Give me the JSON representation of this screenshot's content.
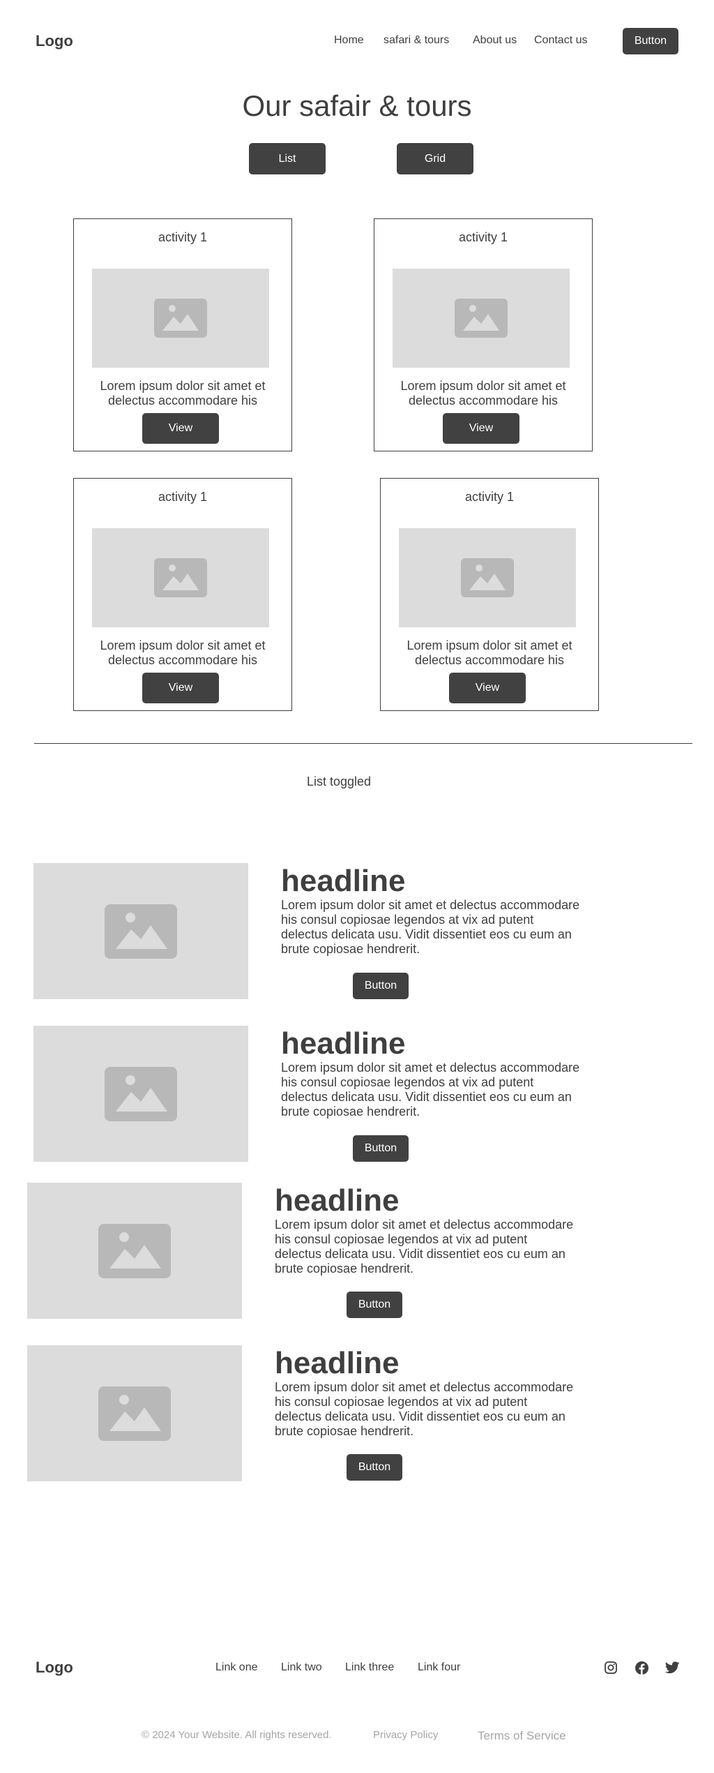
{
  "header": {
    "logo": "Logo",
    "nav": [
      "Home",
      "safari & tours",
      "About us",
      "Contact us"
    ],
    "button_label": "Button"
  },
  "page": {
    "title": "Our safair & tours",
    "view_toggle": [
      "List",
      "Grid"
    ]
  },
  "cards": [
    {
      "title": "activity 1",
      "text_line1": "Lorem ipsum dolor sit amet et",
      "text_line2": "delectus accommodare his",
      "button": "View",
      "image_icon": "image-placeholder-icon"
    },
    {
      "title": "activity 1",
      "text_line1": "Lorem ipsum dolor sit amet et",
      "text_line2": "delectus accommodare his",
      "button": "View",
      "image_icon": "image-placeholder-icon"
    },
    {
      "title": "activity 1",
      "text_line1": "Lorem ipsum dolor sit amet et",
      "text_line2": "delectus accommodare his",
      "button": "View",
      "image_icon": "image-placeholder-icon"
    },
    {
      "title": "activity 1",
      "text_line1": "Lorem ipsum dolor sit amet et",
      "text_line2": "delectus accommodare his",
      "button": "View",
      "image_icon": "image-placeholder-icon"
    }
  ],
  "list_section": {
    "label": "List toggled",
    "items": [
      {
        "headline": "headline",
        "body": "Lorem ipsum dolor sit amet et delectus accommodare his consul copiosae legendos at vix ad putent delectus delicata usu. Vidit dissentiet eos cu eum an brute copiosae hendrerit.",
        "button": "Button"
      },
      {
        "headline": "headline",
        "body": "Lorem ipsum dolor sit amet et delectus accommodare his consul copiosae legendos at vix ad putent delectus delicata usu. Vidit dissentiet eos cu eum an brute copiosae hendrerit.",
        "button": "Button"
      },
      {
        "headline": "headline",
        "body": "Lorem ipsum dolor sit amet et delectus accommodare his consul copiosae legendos at vix ad putent delectus delicata usu. Vidit dissentiet eos cu eum an brute copiosae hendrerit.",
        "button": "Button"
      },
      {
        "headline": "headline",
        "body": "Lorem ipsum dolor sit amet et delectus accommodare his consul copiosae legendos at vix ad putent delectus delicata usu. Vidit dissentiet eos cu eum an brute copiosae hendrerit.",
        "button": "Button"
      }
    ]
  },
  "footer": {
    "logo": "Logo",
    "links": [
      "Link one",
      "Link two",
      "Link three",
      "Link four"
    ],
    "social_icons": [
      "instagram-icon",
      "facebook-icon",
      "twitter-icon"
    ],
    "copyright": "© 2024 Your Website. All rights reserved.",
    "privacy": "Privacy Policy",
    "terms": "Terms of Service"
  },
  "colors": {
    "primary_button": "#414141",
    "text": "#3f3f3f",
    "placeholder_bg": "#dcdcdc",
    "placeholder_icon": "#b8b8b8",
    "muted": "#a6a6a6"
  }
}
